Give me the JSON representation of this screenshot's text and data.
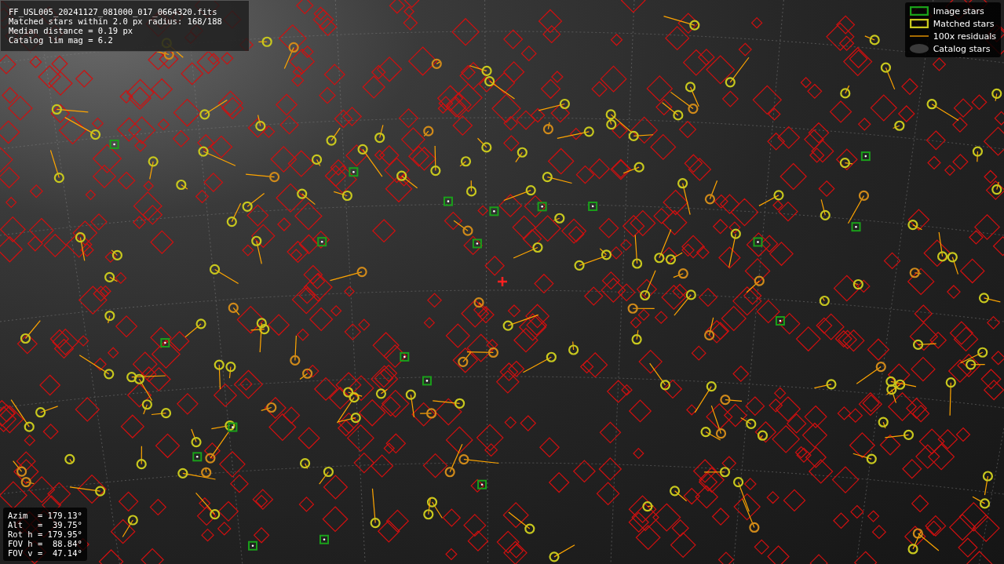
{
  "info_box": {
    "lines": [
      "FF_USL005_20241127_081000_017_0664320.fits",
      "Matched stars within 2.0 px radius: 168/188",
      "Median distance = 0.19 px",
      "Catalog lim mag = 6.2"
    ]
  },
  "legend": [
    {
      "kind": "image",
      "label": "Image stars"
    },
    {
      "kind": "matched",
      "label": "Matched stars"
    },
    {
      "kind": "residual",
      "label": "100x residuals"
    },
    {
      "kind": "catalog",
      "label": "Catalog stars"
    }
  ],
  "pointing": {
    "lines": [
      "Azim  = 179.13°",
      "Alt   =  39.75°",
      "Rot h = 179.95°",
      "FOV h =  88.84°",
      "FOV v =  47.14°"
    ]
  }
}
